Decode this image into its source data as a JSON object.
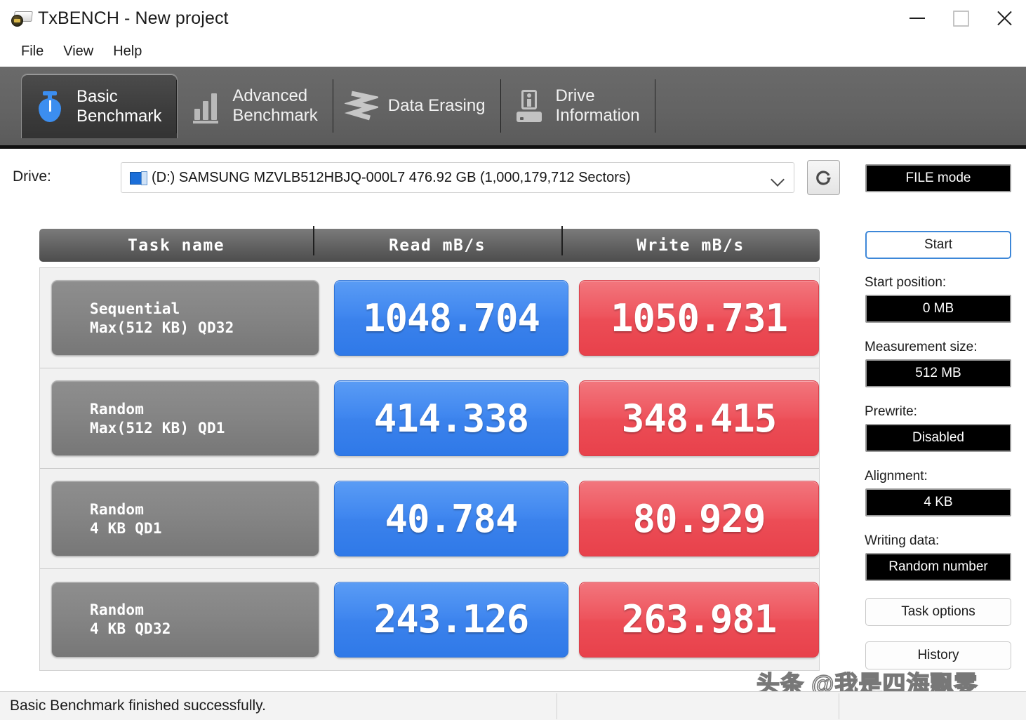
{
  "window": {
    "title": "TxBENCH - New project",
    "icon": "app-drive-icon",
    "controls": {
      "minimize": "minimize-icon",
      "maximize": "maximize-icon",
      "close": "close-icon"
    }
  },
  "menu": {
    "items": [
      {
        "label": "File"
      },
      {
        "label": "View"
      },
      {
        "label": "Help"
      }
    ]
  },
  "tabs": [
    {
      "label": "Basic\nBenchmark",
      "icon": "stopwatch-icon",
      "active": true
    },
    {
      "label": "Advanced\nBenchmark",
      "icon": "bar-chart-icon",
      "active": false
    },
    {
      "label": "Data Erasing",
      "icon": "shredder-icon",
      "active": false
    },
    {
      "label": "Drive\nInformation",
      "icon": "drive-info-icon",
      "active": false
    }
  ],
  "drive": {
    "label": "Drive:",
    "selected": "(D:) SAMSUNG MZVLB512HBJQ-000L7  476.92 GB (1,000,179,712 Sectors)",
    "icon": "disk-icon",
    "refresh_icon": "refresh-icon"
  },
  "table": {
    "headers": {
      "task": "Task name",
      "read": "Read mB/s",
      "write": "Write mB/s"
    },
    "rows": [
      {
        "task_line1": "Sequential",
        "task_line2": "Max(512 KB) QD32",
        "read": "1048.704",
        "write": "1050.731"
      },
      {
        "task_line1": "Random",
        "task_line2": "Max(512 KB) QD1",
        "read": "414.338",
        "write": "348.415"
      },
      {
        "task_line1": "Random",
        "task_line2": "4 KB QD1",
        "read": "40.784",
        "write": "80.929"
      },
      {
        "task_line1": "Random",
        "task_line2": "4 KB QD32",
        "read": "243.126",
        "write": "263.981"
      }
    ]
  },
  "sidebar": {
    "mode": "FILE mode",
    "start_button": "Start",
    "start_position_label": "Start position:",
    "start_position_value": "0 MB",
    "measurement_size_label": "Measurement size:",
    "measurement_size_value": "512 MB",
    "prewrite_label": "Prewrite:",
    "prewrite_value": "Disabled",
    "alignment_label": "Alignment:",
    "alignment_value": "4 KB",
    "writing_data_label": "Writing data:",
    "writing_data_value": "Random number",
    "task_options_button": "Task options",
    "history_button": "History"
  },
  "statusbar": {
    "message": "Basic Benchmark finished successfully."
  },
  "watermark": {
    "text": "头条 @我是四海飘零"
  },
  "colors": {
    "read_blue": "#3b82ec",
    "write_red": "#ec4d56",
    "tab_accent": "#3c8ef0",
    "start_border": "#3d87d8"
  }
}
